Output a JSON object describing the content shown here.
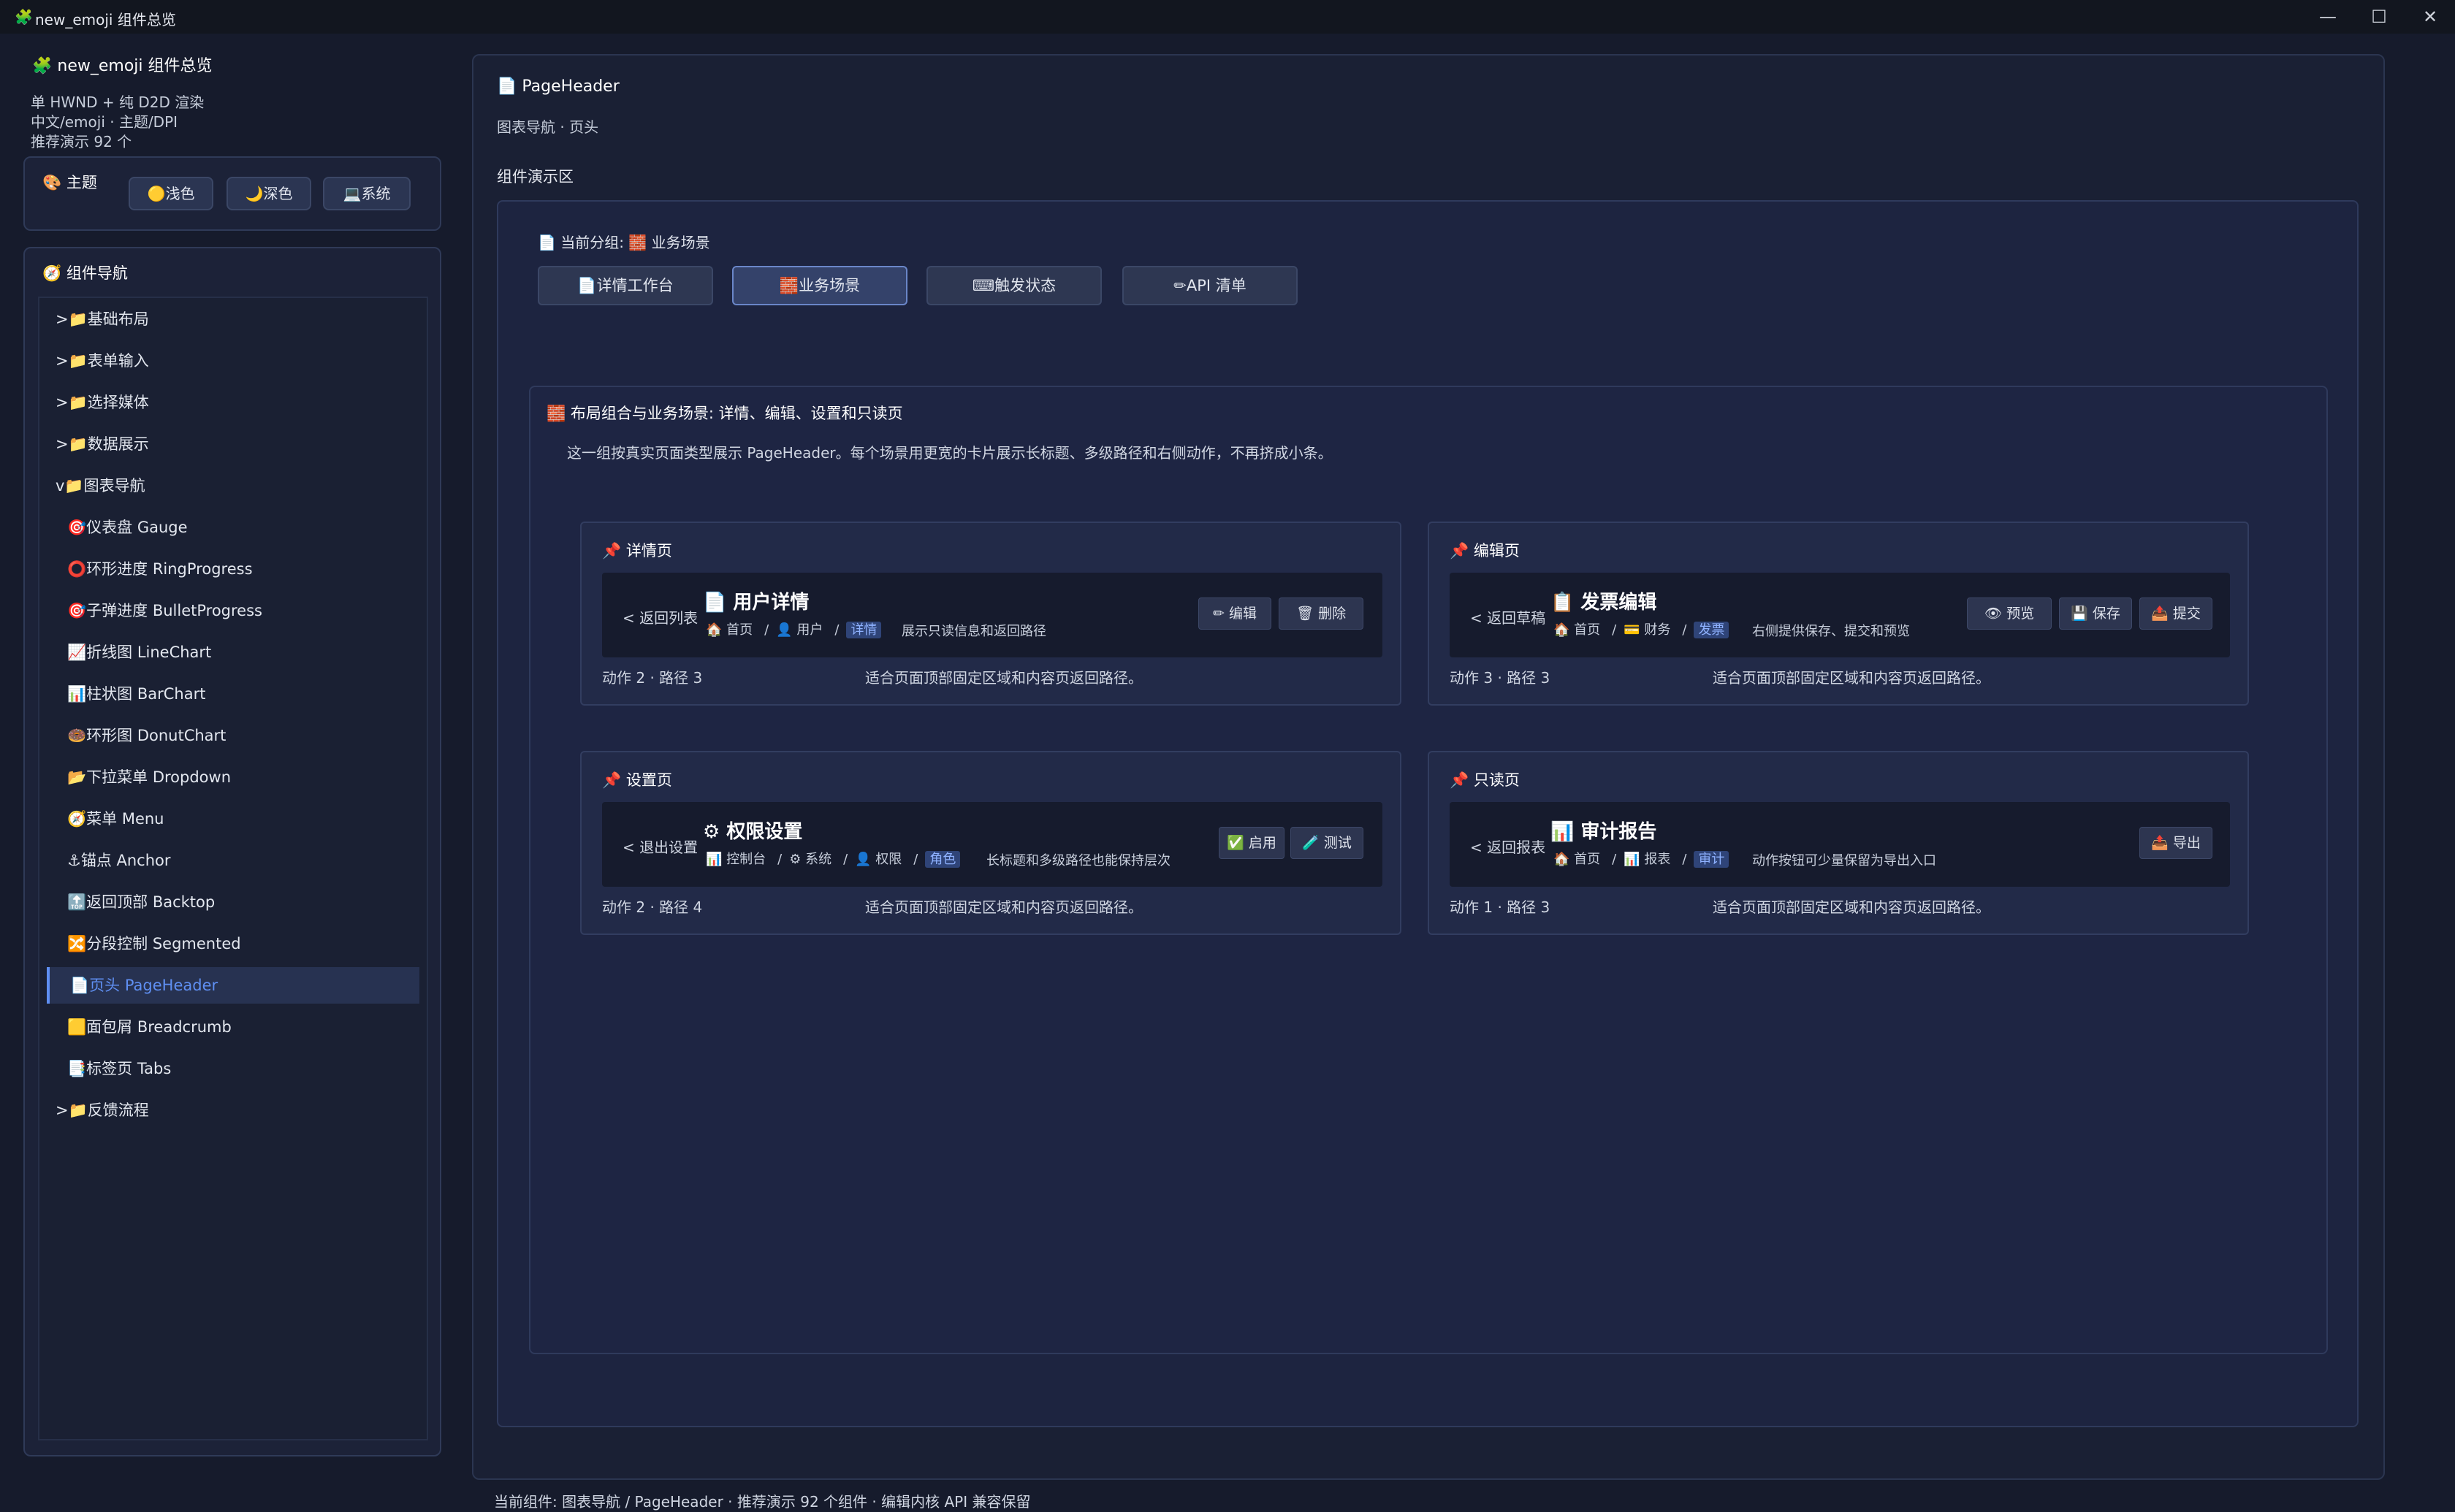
{
  "window": {
    "title": "new_emoji 组件总览",
    "icon": "🧩",
    "controls": [
      "—",
      "☐",
      "✕"
    ]
  },
  "sidebar": {
    "app_title": "🧩 new_emoji 组件总览",
    "info": [
      "单 HWND + 纯 D2D 渲染",
      "中文/emoji · 主题/DPI",
      "推荐演示 92 个"
    ],
    "theme": {
      "heading": "🎨 主题",
      "buttons": [
        "🟡浅色",
        "🌙深色",
        "💻系统"
      ]
    },
    "nav": {
      "heading": "🧭 组件导航",
      "items": [
        {
          "text": ">📁基础布局"
        },
        {
          "text": ">📁表单输入"
        },
        {
          "text": ">📁选择媒体"
        },
        {
          "text": ">📁数据展示"
        },
        {
          "text": "v📁图表导航"
        },
        {
          "text": "🎯仪表盘 Gauge"
        },
        {
          "text": "⭕环形进度 RingProgress"
        },
        {
          "text": "🎯子弹进度 BulletProgress"
        },
        {
          "text": "📈折线图 LineChart"
        },
        {
          "text": "📊柱状图 BarChart"
        },
        {
          "text": "🍩环形图 DonutChart"
        },
        {
          "text": "📂下拉菜单 Dropdown"
        },
        {
          "text": "🧭菜单 Menu"
        },
        {
          "text": "⚓锚点 Anchor"
        },
        {
          "text": "🔝返回顶部 Backtop"
        },
        {
          "text": "🔀分段控制 Segmented"
        },
        {
          "text": "📄页头 PageHeader"
        },
        {
          "text": "🟨面包屑 Breadcrumb"
        },
        {
          "text": "📑标签页 Tabs"
        },
        {
          "text": ">📁反馈流程"
        }
      ]
    }
  },
  "main": {
    "title": "📄 PageHeader",
    "subtitle": "图表导航 · 页头",
    "demo_label": "组件演示区",
    "group_label": "📄 当前分组: 🧱 业务场景",
    "group_buttons": [
      "📄详情工作台",
      "🧱业务场景",
      "⌨触发状态",
      "✏API 清单"
    ],
    "scene_title": "🧱 布局组合与业务场景: 详情、编辑、设置和只读页",
    "scene_desc": "这一组按真实页面类型展示 PageHeader。每个场景用更宽的卡片展示长标题、多级路径和右侧动作，不再挤成小条。",
    "cards": [
      {
        "heading": "📌 详情页",
        "back": "< 返回列表",
        "title": "📄 用户详情",
        "crumbs": [
          "🏠 首页",
          "👤 用户"
        ],
        "current": "详情",
        "desc": "展示只读信息和返回路径",
        "actions": [
          "✏ 编辑",
          "🗑 删除"
        ],
        "foot_left": "动作 2 · 路径 3",
        "foot_right": "适合页面顶部固定区域和内容页返回路径。"
      },
      {
        "heading": "📌 编辑页",
        "back": "< 返回草稿",
        "title": "📋 发票编辑",
        "crumbs": [
          "🏠 首页",
          "💳 财务"
        ],
        "current": "发票",
        "desc": "右侧提供保存、提交和预览",
        "actions": [
          "👁 预览",
          "💾 保存",
          "📤 提交"
        ],
        "foot_left": "动作 3 · 路径 3",
        "foot_right": "适合页面顶部固定区域和内容页返回路径。"
      },
      {
        "heading": "📌 设置页",
        "back": "< 退出设置",
        "title": "⚙ 权限设置",
        "crumbs": [
          "📊 控制台",
          "⚙ 系统",
          "👤 权限"
        ],
        "current": "角色",
        "desc": "长标题和多级路径也能保持层次",
        "actions": [
          "✅ 启用",
          "🧪 测试"
        ],
        "foot_left": "动作 2 · 路径 4",
        "foot_right": "适合页面顶部固定区域和内容页返回路径。"
      },
      {
        "heading": "📌 只读页",
        "back": "< 返回报表",
        "title": "📊 审计报告",
        "crumbs": [
          "🏠 首页",
          "📊 报表"
        ],
        "current": "审计",
        "desc": "动作按钮可少量保留为导出入口",
        "actions": [
          "📤 导出"
        ],
        "foot_left": "动作 1 · 路径 3",
        "foot_right": "适合页面顶部固定区域和内容页返回路径。"
      }
    ]
  },
  "status": "当前组件: 图表导航 / PageHeader · 推荐演示 92 个组件 · 编辑内核 API 兼容保留"
}
